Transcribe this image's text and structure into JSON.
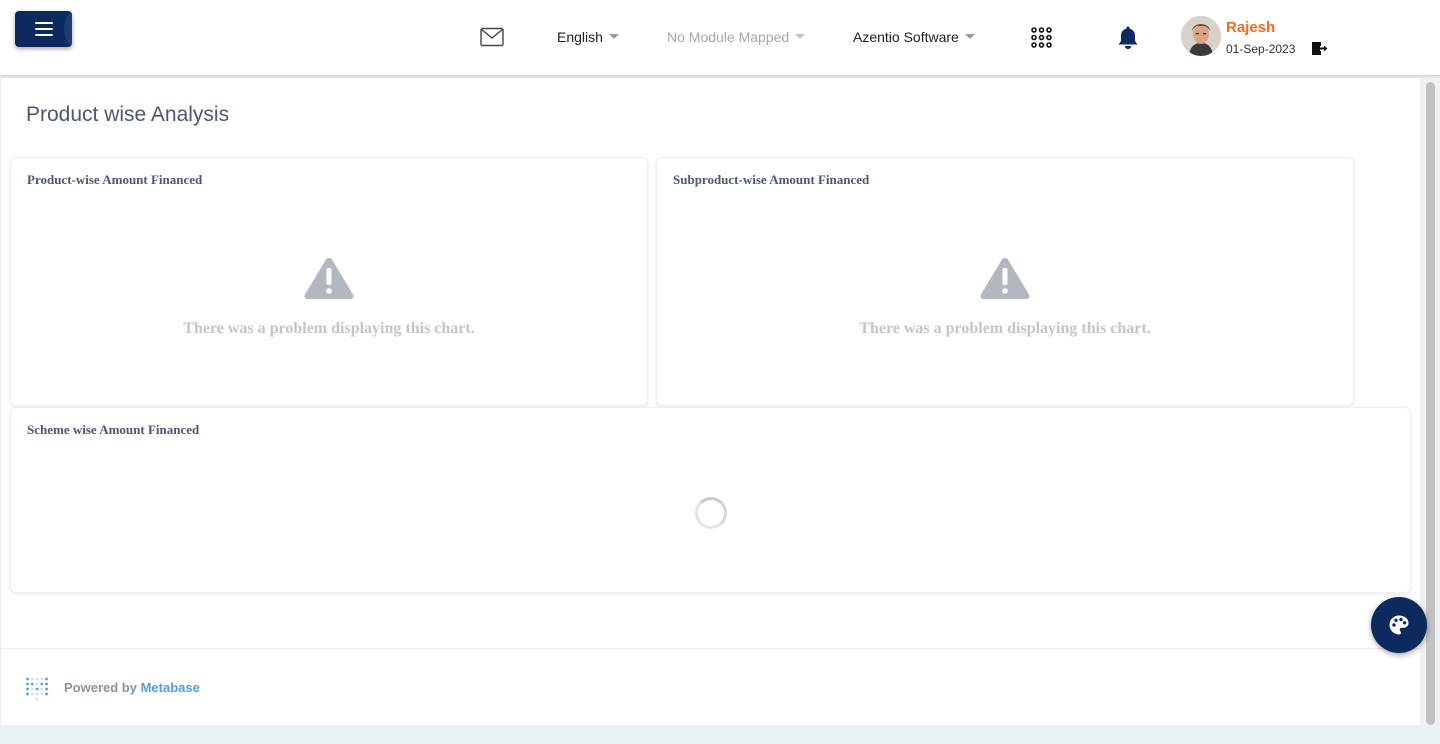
{
  "header": {
    "language": "English",
    "module": "No Module Mapped",
    "company": "Azentio Software",
    "user": {
      "name": "Rajesh",
      "date": "01-Sep-2023"
    }
  },
  "page": {
    "title": "Product wise Analysis"
  },
  "cards": [
    {
      "title": "Product-wise Amount Financed",
      "error": "There was a problem displaying this chart."
    },
    {
      "title": "Subproduct-wise Amount Financed",
      "error": "There was a problem displaying this chart."
    },
    {
      "title": "Scheme wise Amount Financed"
    }
  ],
  "footer": {
    "powered_by": "Powered by",
    "brand": "Metabase"
  },
  "colors": {
    "primary": "#0d2a5e",
    "user_name": "#f26a1b",
    "title": "#4c5773",
    "error_text": "#c2c5cc",
    "link": "#509ee3"
  },
  "icons": [
    "menu-icon",
    "mail-icon",
    "apps-grid-icon",
    "bell-icon",
    "logout-icon",
    "warning-icon",
    "metabase-logo-icon",
    "palette-icon"
  ]
}
